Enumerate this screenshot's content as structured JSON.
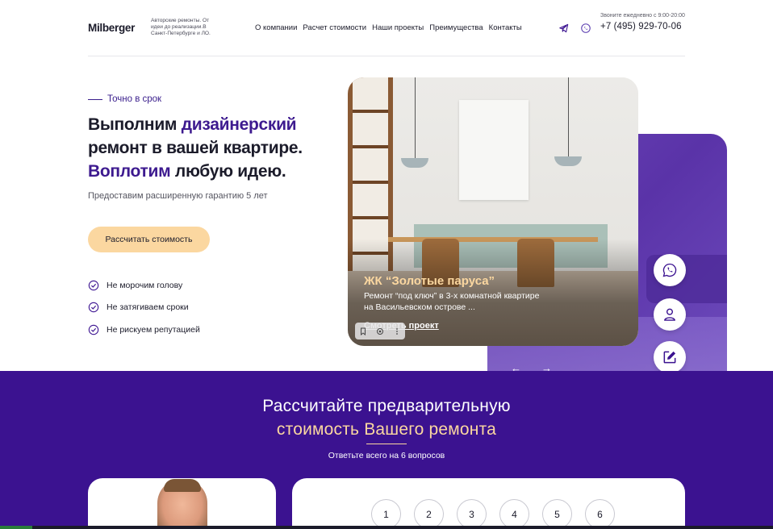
{
  "header": {
    "logo": "Milberger",
    "tagline": "Авторские ремонты. От идеи до реализации.В Санкт-Петербурге и ЛО.",
    "nav": [
      "О компании",
      "Расчет стоимости",
      "Наши проекты",
      "Преимущества",
      "Контакты"
    ],
    "hours": "Звоните ежедневно с 9:00-20:00",
    "phone": "+7 (495) 929-70-06",
    "icons": [
      "telegram-icon",
      "viber-icon"
    ]
  },
  "hero": {
    "eyebrow": "Точно в срок",
    "headline": {
      "p1": "Выполним ",
      "p2": "дизайнерский",
      "p3": " ремонт в вашей квартире. ",
      "p4": "Воплотим",
      "p5": " любую идею."
    },
    "subhead": "Предоставим расширенную гарантию 5 лет",
    "cta": "Рассчитать стоимость",
    "benefits": [
      "Не морочим голову",
      "Не затягиваем сроки",
      "Не рискуем репутацией"
    ]
  },
  "project": {
    "title": "ЖК “Золотые паруса”",
    "description": "Ремонт “под ключ” в 3-х комнатной квартире на Васильевском острове ...",
    "link": "Смотреть проект",
    "prev": "←",
    "next": "→"
  },
  "floating_actions": [
    "whatsapp-icon",
    "user-icon",
    "edit-icon"
  ],
  "calc": {
    "title_line1": "Рассчитайте предварительную",
    "title_line2": "стоимость Вашего ремонта",
    "note": "Ответьте всего на 6 вопросов",
    "steps": [
      "1",
      "2",
      "3",
      "4",
      "5",
      "6"
    ]
  },
  "colors": {
    "accent_purple": "#3b1290",
    "accent_peach": "#fbd7a0",
    "text_dark": "#1b1b2a"
  }
}
